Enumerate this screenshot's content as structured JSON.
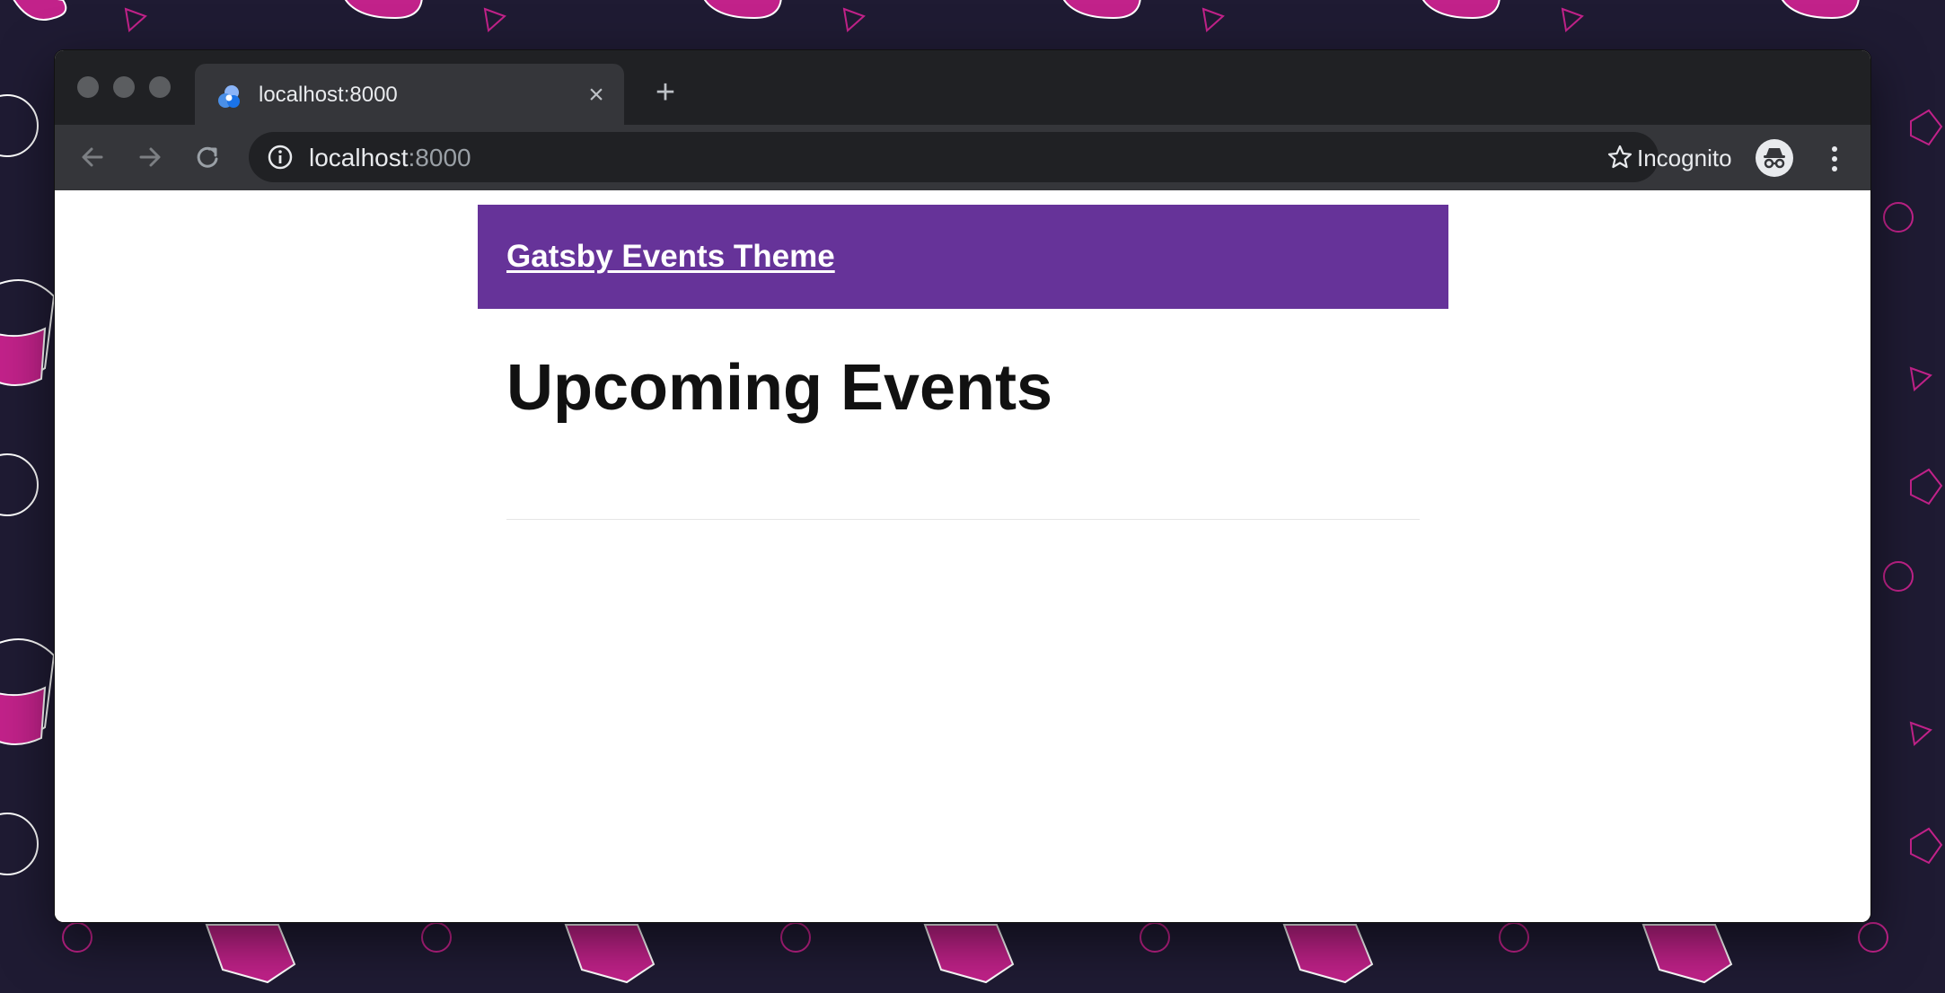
{
  "browser": {
    "tab": {
      "title": "localhost:8000",
      "favicon": "gatsby-theme-icon",
      "close_icon": "close-icon"
    },
    "new_tab_icon": "plus-icon",
    "toolbar": {
      "back_icon": "back-arrow-icon",
      "forward_icon": "forward-arrow-icon",
      "reload_icon": "reload-icon",
      "info_icon": "info-icon",
      "url_host": "localhost",
      "url_port": ":8000",
      "bookmark_icon": "star-icon",
      "profile_label": "Incognito",
      "profile_icon": "incognito-icon",
      "menu_icon": "more-vert-icon"
    }
  },
  "page": {
    "site_title": "Gatsby Events Theme",
    "heading": "Upcoming Events"
  },
  "colors": {
    "header_purple": "#663399",
    "wallpaper_bg": "#1f1b33",
    "wallpaper_accent": "#c2228a"
  }
}
